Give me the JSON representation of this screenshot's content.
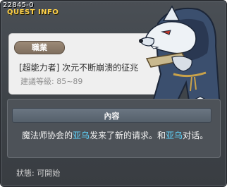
{
  "header": {
    "quest_id": "22845-0",
    "label": "QUEST INFO"
  },
  "quest": {
    "job_badge": "職業",
    "title": "[超能力者] 次元不断崩溃的征兆",
    "required_level": "建議等級: 85~89"
  },
  "content": {
    "header": "內容",
    "text_part1": "魔法师协会的",
    "npc_name_1": "亚乌",
    "text_part2": "发来了新的请求。和",
    "npc_name_2": "亚乌",
    "text_part3": "对话。"
  },
  "status": {
    "text": "狀態:  可開始"
  },
  "colors": {
    "accent_title": "#ffd24a",
    "npc_highlight": "#5fd6ff",
    "window_bg": "#3d4247"
  },
  "icons": {
    "portrait": "wolf-npc-portrait"
  }
}
